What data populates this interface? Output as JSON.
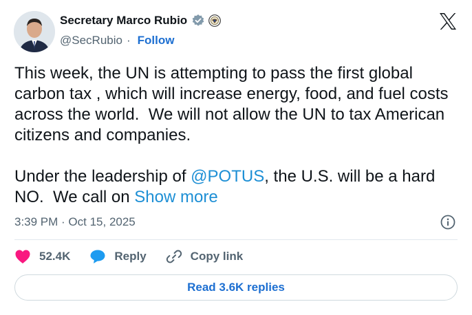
{
  "author": {
    "name": "Secretary Marco Rubio",
    "handle": "@SecRubio",
    "separator": "·",
    "follow_label": "Follow"
  },
  "post": {
    "text_part1": "This week, the UN is attempting to pass the first global carbon tax , which will increase energy, food, and fuel costs across the world.  We will not allow the UN to tax American citizens and companies.\n\nUnder the leadership of ",
    "mention": "@POTUS",
    "text_part2": ", the U.S. will be a hard NO.  We call on ",
    "show_more": "Show more"
  },
  "timestamp": "3:39 PM · Oct 15, 2025",
  "actions": {
    "likes": "52.4K",
    "reply_label": "Reply",
    "copy_link_label": "Copy link"
  },
  "read_replies_label": "Read 3.6K replies",
  "colors": {
    "link": "#1d8fd5",
    "heart": "#f91880",
    "reply_bubble": "#1d9bf0",
    "verified_badge": "#829aab"
  }
}
